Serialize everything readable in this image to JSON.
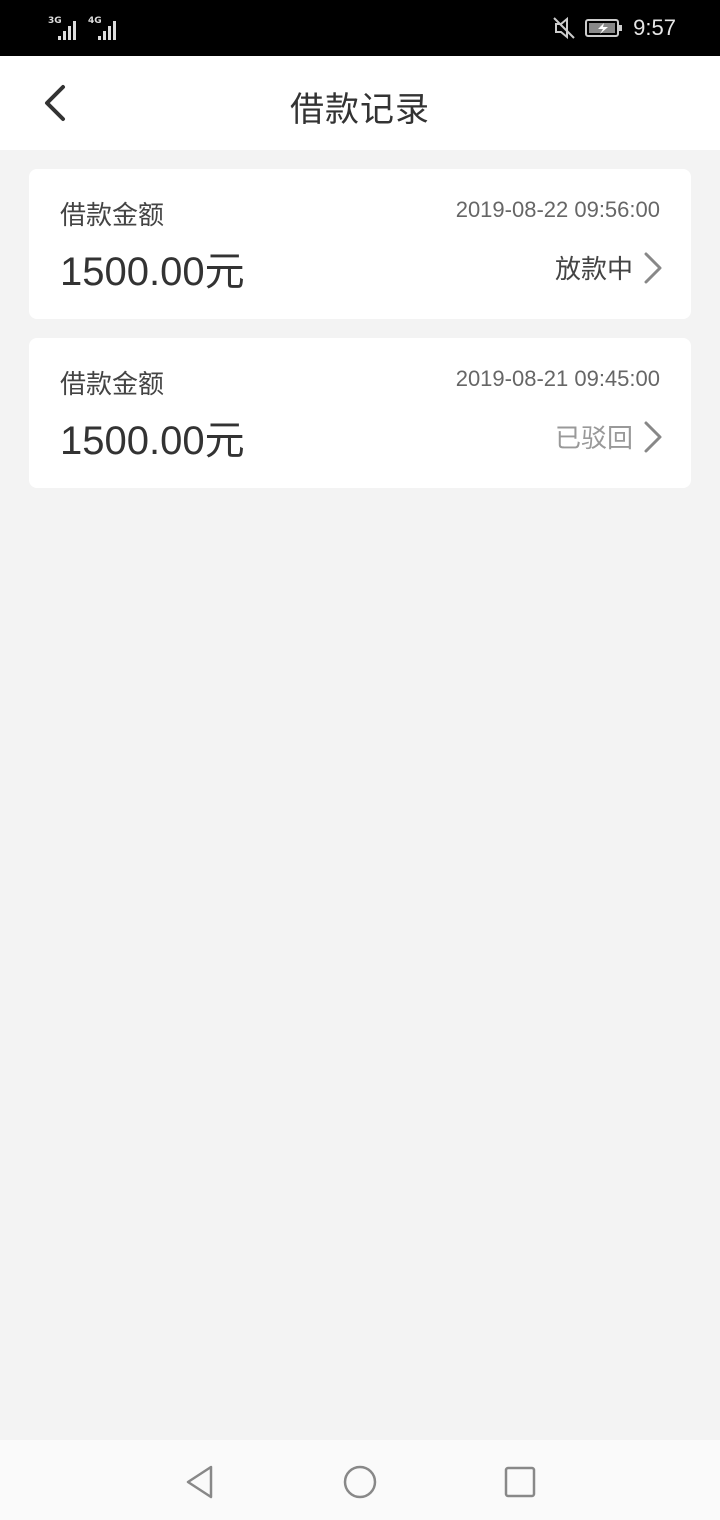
{
  "status_bar": {
    "time": "9:57",
    "sim1": "3G",
    "sim2": "4G"
  },
  "header": {
    "title": "借款记录"
  },
  "records": [
    {
      "label": "借款金额",
      "date": "2019-08-22 09:56:00",
      "amount": "1500.00元",
      "status": "放款中"
    },
    {
      "label": "借款金额",
      "date": "2019-08-21 09:45:00",
      "amount": "1500.00元",
      "status": "已驳回"
    }
  ],
  "colors": {
    "background": "#f3f3f3",
    "card": "#ffffff",
    "status_active": "#444444",
    "status_rejected": "#999999"
  },
  "icons": {
    "back": "chevron-left-icon",
    "row_arrow": "chevron-right-icon",
    "nav_back": "triangle-back-icon",
    "nav_home": "circle-home-icon",
    "nav_recent": "square-recent-icon"
  }
}
